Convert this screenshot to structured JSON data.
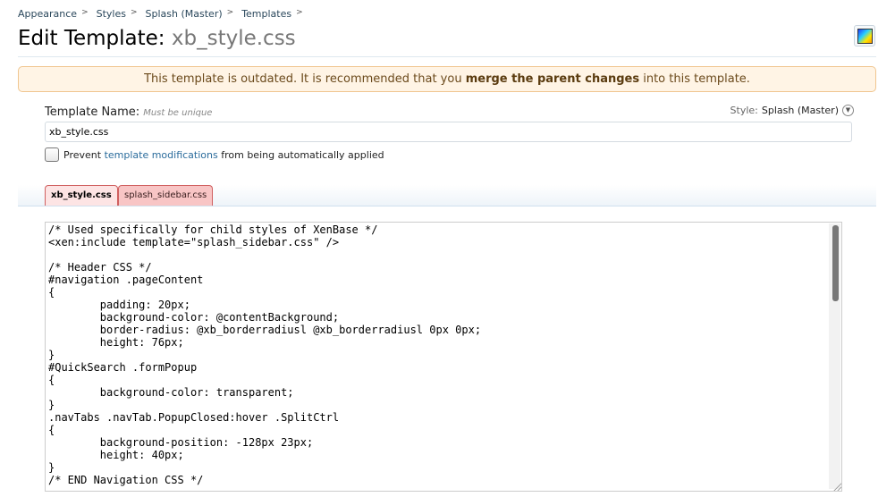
{
  "breadcrumb": [
    "Appearance",
    "Styles",
    "Splash (Master)",
    "Templates"
  ],
  "title": {
    "prefix": "Edit Template:",
    "name": "xb_style.css"
  },
  "icons": {
    "style_chooser": "color-swatch-icon",
    "style_dropdown": "chevron-down-icon",
    "crumb_separator": "chevron-right-icon"
  },
  "notice": {
    "before": "This template is outdated. It is recommended that you ",
    "link": "merge the parent changes",
    "after": " into this template."
  },
  "form": {
    "name_label": "Template Name:",
    "name_hint": "Must be unique",
    "name_value": "xb_style.css",
    "style_label": "Style:",
    "style_value": "Splash (Master)",
    "prevent_before": "Prevent ",
    "prevent_link": "template modifications",
    "prevent_after": " from being automatically applied"
  },
  "tabs": [
    {
      "label": "xb_style.css",
      "active": true
    },
    {
      "label": "splash_sidebar.css",
      "active": false
    }
  ],
  "code": "/* Used specifically for child styles of XenBase */\n<xen:include template=\"splash_sidebar.css\" />\n\n/* Header CSS */\n#navigation .pageContent\n{\n\tpadding: 20px;\n\tbackground-color: @contentBackground;\n\tborder-radius: @xb_borderradiusl @xb_borderradiusl 0px 0px;\n\theight: 76px;\n}\n#QuickSearch .formPopup\n{\n\tbackground-color: transparent;\n}\n.navTabs .navTab.PopupClosed:hover .SplitCtrl\n{\n\tbackground-position: -128px 23px;\n\theight: 40px;\n}\n/* END Navigation CSS */",
  "colors": {
    "notice_bg": "#fff4e5",
    "notice_border": "#f0c690",
    "tab_active": "#fde4e4",
    "tab_inactive": "#f8c5c5",
    "link": "#2b6c9c"
  }
}
